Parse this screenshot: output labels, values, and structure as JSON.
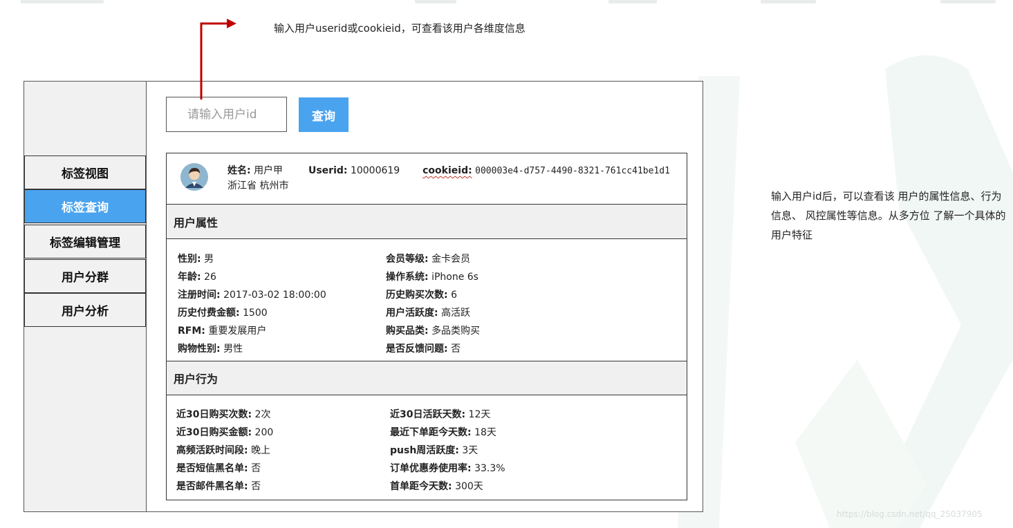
{
  "annotation": {
    "arrow_note": "输入用户userid或cookieid，可查看该用户各维度信息",
    "side_note": "输入用户id后，可以查看该 用户的属性信息、行为信息、 风控属性等信息。从多方位 了解一个具体的用户特征",
    "watermark": "https://blog.csdn.net/qq_25037905",
    "arrow_color": "#c00000"
  },
  "sidebar": {
    "items": [
      {
        "label": "标签视图"
      },
      {
        "label": "标签查询"
      },
      {
        "label": "标签编辑管理"
      },
      {
        "label": "用户分群"
      },
      {
        "label": "用户分析"
      }
    ],
    "active": "标签查询",
    "accent_color": "#4aa3ef"
  },
  "search": {
    "placeholder": "请输入用户id",
    "button_label": "查询"
  },
  "user": {
    "name_label": "姓名:",
    "name_value": "用户甲",
    "userid_label": "Userid:",
    "userid_value": "10000619",
    "cookieid_label": "cookieid:",
    "cookieid_value": "000003e4-d757-4490-8321-761cc41be1d1",
    "location": "浙江省  杭州市"
  },
  "attributes": {
    "title": "用户属性",
    "left": [
      {
        "label": "性别:",
        "value": "男"
      },
      {
        "label": "年龄:",
        "value": "26"
      },
      {
        "label": "注册时间:",
        "value": "2017-03-02 18:00:00"
      },
      {
        "label": "历史付费金额:",
        "value": "1500"
      },
      {
        "label": "RFM:",
        "value": "重要发展用户"
      },
      {
        "label": "购物性别:",
        "value": "男性"
      }
    ],
    "right": [
      {
        "label": "会员等级:",
        "value": "金卡会员"
      },
      {
        "label": "操作系统:",
        "value": "iPhone 6s"
      },
      {
        "label": "历史购买次数:",
        "value": "6"
      },
      {
        "label": "用户活跃度:",
        "value": "高活跃"
      },
      {
        "label": "购买品类:",
        "value": "多品类购买"
      },
      {
        "label": "是否反馈问题:",
        "value": "否"
      }
    ]
  },
  "behavior": {
    "title": "用户行为",
    "left": [
      {
        "label": "近30日购买次数:",
        "value": "2次"
      },
      {
        "label": "近30日购买金额:",
        "value": "200"
      },
      {
        "label": "高频活跃时间段:",
        "value": "晚上"
      },
      {
        "label": "是否短信黑名单:",
        "value": "否"
      },
      {
        "label": "是否邮件黑名单:",
        "value": "否"
      }
    ],
    "right": [
      {
        "label": "近30日活跃天数:",
        "value": "12天"
      },
      {
        "label": "最近下单距今天数:",
        "value": "18天"
      },
      {
        "label": "push周活跃度:",
        "value": "3天"
      },
      {
        "label": "订单优惠券使用率:",
        "value": "33.3%"
      },
      {
        "label": "首单距今天数:",
        "value": "300天"
      }
    ]
  }
}
